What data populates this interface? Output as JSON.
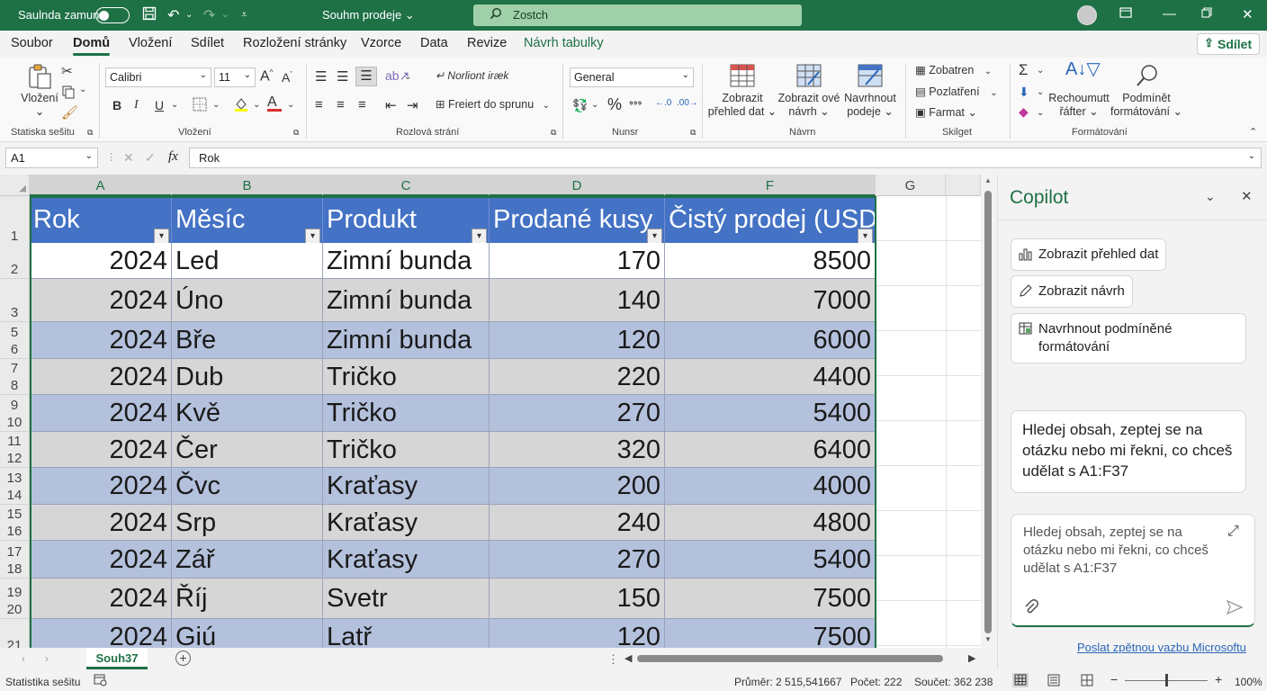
{
  "titlebar": {
    "autosave_label": "Saulnda zamun",
    "doc_title": "Souhm prodeje",
    "doc_chevron": "⌄",
    "search_placeholder": "Zostch"
  },
  "tabs": [
    "Soubor",
    "Domů",
    "Vložení",
    "Sdílet",
    "Rozložení stránky",
    "Vzorce",
    "Data",
    "Revize",
    "Návrh tabulky"
  ],
  "share_label": "Sdílet",
  "ribbon": {
    "clipboard": {
      "paste": "Vložení",
      "group": "Statiska sešitu"
    },
    "font": {
      "name": "Calibri",
      "size": "11",
      "group": "Vložení"
    },
    "alignment": {
      "wrap": "Norliont iræk",
      "merge": "Freiert do sprunu",
      "group": "Rozlová strání"
    },
    "number": {
      "format": "General",
      "group": "Nunsr"
    },
    "styles": {
      "a": [
        "Zobrazit",
        "přehled dat ⌄"
      ],
      "b": [
        "Zobrazit ové",
        "návrh ⌄"
      ],
      "c": [
        "Navrhnout",
        "podeje ⌄"
      ],
      "group": "Návrn"
    },
    "cells": {
      "insert": "Zobatren",
      "delete": "Pozlatření",
      "format": "Farmat ⌄",
      "group": "Skilget"
    },
    "editing": {
      "sort": [
        "Rechoumutt",
        "řáfter ⌄"
      ],
      "cond": [
        "Podmínět",
        "formátování ⌄"
      ],
      "group": "Formátování"
    }
  },
  "formula": {
    "namebox": "A1",
    "fx_label": "fx",
    "content": "Rok"
  },
  "columns": [
    "A",
    "B",
    "C",
    "D",
    "E",
    "F",
    "G"
  ],
  "table": {
    "headers": [
      "Rok",
      "Měsíc",
      "Produkt",
      "Prodané kusy",
      "Čistý prodej (USD)"
    ],
    "rows": [
      {
        "rownum": "2",
        "year": "2024",
        "month": "Led",
        "product": "Zimní bunda",
        "units": "170",
        "sales": "8500"
      },
      {
        "rownum": "3",
        "year": "2024",
        "month": "Úno",
        "product": "Zimní bunda",
        "units": "140",
        "sales": "7000"
      },
      {
        "rownum": "5\n6",
        "year": "2024",
        "month": "Bře",
        "product": "Zimní bunda",
        "units": "120",
        "sales": "6000"
      },
      {
        "rownum": "7\n8",
        "year": "2024",
        "month": "Dub",
        "product": "Tričko",
        "units": "220",
        "sales": "4400"
      },
      {
        "rownum": "9\n10",
        "year": "2024",
        "month": "Kvě",
        "product": "Tričko",
        "units": "270",
        "sales": "5400"
      },
      {
        "rownum": "11\n12",
        "year": "2024",
        "month": "Čer",
        "product": "Tričko",
        "units": "320",
        "sales": "6400"
      },
      {
        "rownum": "13\n14",
        "year": "2024",
        "month": "Čvc",
        "product": "Kraťasy",
        "units": "200",
        "sales": "4000"
      },
      {
        "rownum": "15\n16",
        "year": "2024",
        "month": "Srp",
        "product": "Kraťasy",
        "units": "240",
        "sales": "4800"
      },
      {
        "rownum": "17\n18",
        "year": "2024",
        "month": "Zář",
        "product": "Kraťasy",
        "units": "270",
        "sales": "5400"
      },
      {
        "rownum": "19\n20",
        "year": "2024",
        "month": "Říj",
        "product": "Svetr",
        "units": "150",
        "sales": "7500"
      },
      {
        "rownum": "21",
        "year": "2024",
        "month": "Giú",
        "product": "Latř",
        "units": "120",
        "sales": "7500"
      }
    ]
  },
  "sheet_tab": "Souh37",
  "status": {
    "left": "Statistika sešitu",
    "average": "Průměr: 2 515,541667",
    "count": "Počet: 222",
    "sum": "Součet: 362 238",
    "zoom": "100%"
  },
  "copilot": {
    "title": "Copilot",
    "btn_overview": "Zobrazit přehled dat",
    "btn_design": "Zobrazit návrh",
    "btn_cond": "Navrhnout podmíněné formátování",
    "message": "Hledej obsah, zeptej se na otázku nebo mi řekni, co chceš udělat s A1:F37",
    "compose": "Hledej obsah, zeptej se na otázku nebo mi řekni, co chceš udělat s A1:F37",
    "feedback": "Poslat zpětnou vazbu Microsoftu"
  },
  "colors": {
    "brand": "#1e7145",
    "table_header": "#4472c4",
    "band": "#b4c1dc"
  }
}
